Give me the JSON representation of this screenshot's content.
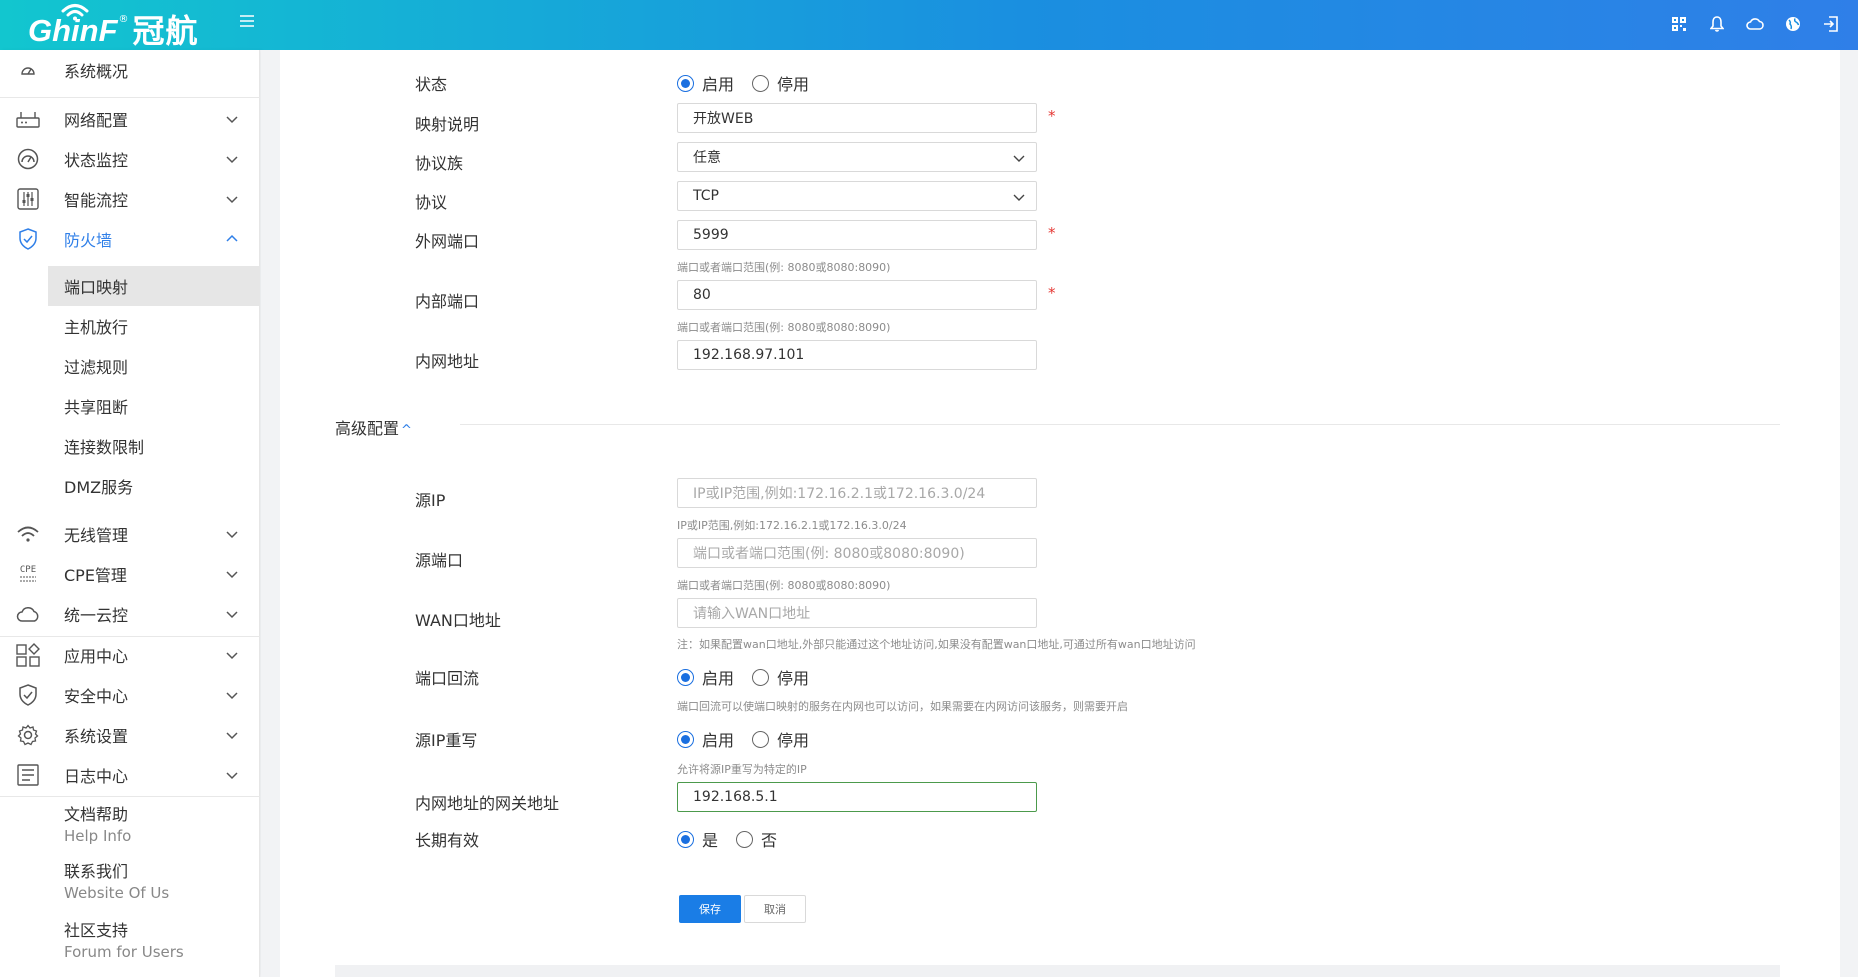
{
  "header": {
    "logo_text": "GhinF",
    "logo_reg": "®",
    "logo_cn": "冠航"
  },
  "sidebar": {
    "items": [
      {
        "label": "系统概况",
        "icon": "dashboard-icon"
      },
      {
        "label": "网络配置",
        "icon": "router-icon"
      },
      {
        "label": "状态监控",
        "icon": "gauge-icon"
      },
      {
        "label": "智能流控",
        "icon": "sliders-icon"
      },
      {
        "label": "防火墙",
        "icon": "shield-icon"
      },
      {
        "label": "无线管理",
        "icon": "wifi-icon"
      },
      {
        "label": "CPE管理",
        "icon": "cpe-icon"
      },
      {
        "label": "统一云控",
        "icon": "cloud-icon"
      },
      {
        "label": "应用中心",
        "icon": "apps-icon"
      },
      {
        "label": "安全中心",
        "icon": "security-shield-icon"
      },
      {
        "label": "系统设置",
        "icon": "gear-icon"
      },
      {
        "label": "日志中心",
        "icon": "log-icon"
      }
    ],
    "firewall_sub": [
      "端口映射",
      "主机放行",
      "过滤规则",
      "共享阻断",
      "连接数限制",
      "DMZ服务"
    ],
    "cpe_icon_text": "CPE",
    "help": [
      {
        "title": "文档帮助",
        "subtitle": "Help Info"
      },
      {
        "title": "联系我们",
        "subtitle": "Website Of Us"
      },
      {
        "title": "社区支持",
        "subtitle": "Forum for Users"
      }
    ]
  },
  "form": {
    "status": {
      "label": "状态",
      "on": "启用",
      "off": "停用"
    },
    "desc": {
      "label": "映射说明",
      "value": "开放WEB"
    },
    "family": {
      "label": "协议族",
      "value": "任意"
    },
    "protocol": {
      "label": "协议",
      "value": "TCP"
    },
    "wan_port": {
      "label": "外网端口",
      "value": "5999",
      "hint": "端口或者端口范围(例: 8080或8080:8090)"
    },
    "lan_port": {
      "label": "内部端口",
      "value": "80",
      "hint": "端口或者端口范围(例: 8080或8080:8090)"
    },
    "lan_addr": {
      "label": "内网地址",
      "value": "192.168.97.101"
    },
    "required_mark": "*"
  },
  "advanced": {
    "title": "高级配置",
    "caret": "^",
    "src_ip": {
      "label": "源IP",
      "placeholder": "IP或IP范围,例如:172.16.2.1或172.16.3.0/24",
      "hint": "IP或IP范围,例如:172.16.2.1或172.16.3.0/24"
    },
    "src_port": {
      "label": "源端口",
      "placeholder": "端口或者端口范围(例: 8080或8080:8090)",
      "hint": "端口或者端口范围(例: 8080或8080:8090)"
    },
    "wan_addr": {
      "label": "WAN口地址",
      "placeholder": "请输入WAN口地址",
      "hint": "注：如果配置wan口地址,外部只能通过这个地址访问,如果没有配置wan口地址,可通过所有wan口地址访问"
    },
    "loopback": {
      "label": "端口回流",
      "on": "启用",
      "off": "停用",
      "hint": "端口回流可以使端口映射的服务在内网也可以访问，如果需要在内网访问该服务，则需要开启"
    },
    "src_rewrite": {
      "label": "源IP重写",
      "on": "启用",
      "off": "停用",
      "hint": "允许将源IP重写为特定的IP"
    },
    "gateway": {
      "label": "内网地址的网关地址",
      "value": "192.168.5.1"
    },
    "permanent": {
      "label": "长期有效",
      "yes": "是",
      "no": "否"
    }
  },
  "buttons": {
    "save": "保存",
    "cancel": "取消"
  },
  "colors": {
    "accent": "#1a7de6",
    "header_start": "#12c6cf",
    "header_end": "#2f7fe8",
    "required": "#e53935"
  }
}
